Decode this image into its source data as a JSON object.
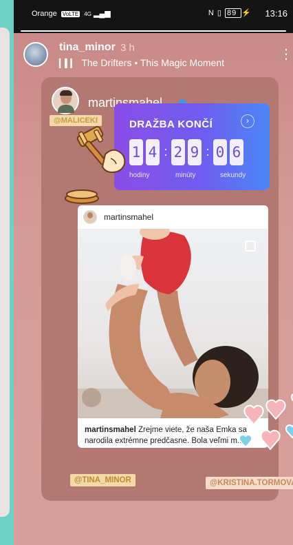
{
  "status_bar": {
    "carrier": "Orange",
    "network_badge": "VoLTE",
    "signal": "4G",
    "battery": "89",
    "time": "13:16"
  },
  "story": {
    "username": "tina_minor",
    "time_ago": "3 h",
    "music": "The Drifters • This Magic Moment",
    "more_icon": "more-vertical-icon",
    "progress_fraction": 1.0
  },
  "repost": {
    "username": "martinsmahel",
    "mention_top": "@MALICEKI",
    "mention_bottom_left": "@TINA_MINOR",
    "mention_bottom_right": "@KRISTINA.TORMOVA"
  },
  "countdown": {
    "title": "DRAŽBA KONČÍ",
    "digits": [
      "1",
      "4",
      "2",
      "9",
      "0",
      "6"
    ],
    "labels": {
      "hours": "hodiny",
      "minutes": "minúty",
      "seconds": "sekundy"
    }
  },
  "post": {
    "username": "martinsmahel",
    "caption_user": "martinsmahel",
    "caption_text": " Zrejme viete, že naša Emka sa narodila extrémne predčasne. Bola veľmi m..."
  },
  "colors": {
    "story_bg": "#d49995",
    "frame_bg": "#b37872",
    "countdown_start": "#8b4de6",
    "countdown_end": "#4b86f6",
    "verified": "#3897f0"
  }
}
